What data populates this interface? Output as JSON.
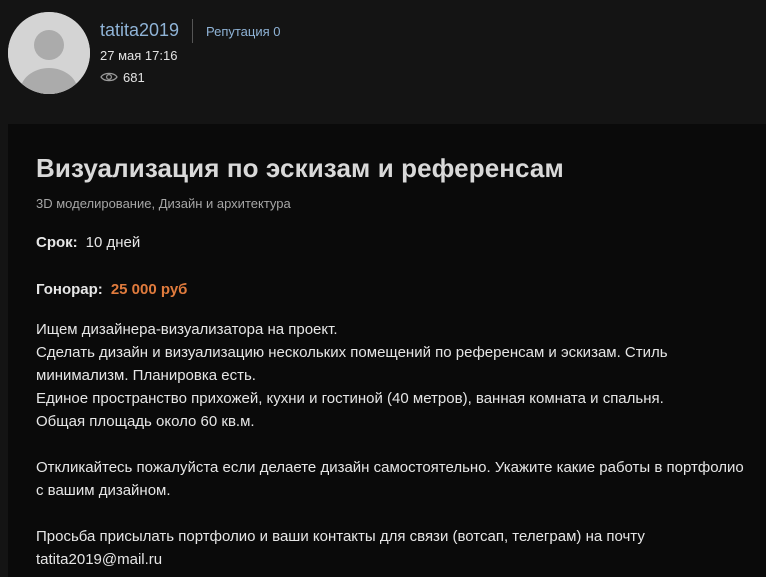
{
  "author": {
    "username": "tatita2019",
    "reputation": "Репутация 0",
    "date": "27 мая 17:16",
    "views": "681"
  },
  "icons": {
    "avatar": "default-user-avatar",
    "views": "eye-icon"
  },
  "colors": {
    "link": "#8fb3d6",
    "fee": "#e07b3d",
    "background": "#141414",
    "card": "#0a0a0a"
  },
  "project": {
    "title": "Визуализация по эскизам и референсам",
    "categories": "3D моделирование, Дизайн и архитектура",
    "term_label": "Срок:",
    "term_value": "10 дней",
    "fee_label": "Гонорар:",
    "fee_value": "25 000 руб",
    "description": [
      "Ищем дизайнера-визуализатора на проект.\nСделать дизайн и визуализацию нескольких помещений по референсам и эскизам. Стиль минимализм. Планировка есть.\nЕдиное пространство прихожей, кухни и гостиной (40 метров), ванная комната и спальня.\nОбщая площадь около 60 кв.м.",
      "Откликайтесь пожалуйста если делаете дизайн самостоятельно. Укажите какие работы в портфолио с вашим дизайном.",
      "Просьба присылать портфолио и ваши контакты для связи (вотсап, телеграм) на почту tatita2019@mail.ru"
    ]
  }
}
